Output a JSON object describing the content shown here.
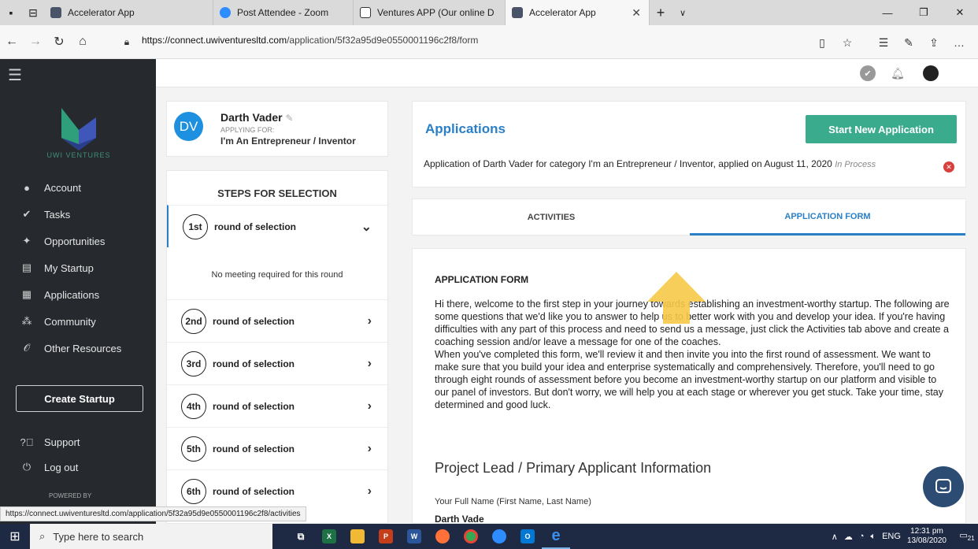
{
  "browser": {
    "tabs": [
      {
        "label": "Accelerator App",
        "color": "#4a5468"
      },
      {
        "label": "Post Attendee - Zoom",
        "color": "#2d8cff"
      },
      {
        "label": "Ventures APP (Our online D",
        "color": "#ffffff"
      },
      {
        "label": "Accelerator App",
        "color": "#4a5468",
        "active": true
      }
    ],
    "url_host": "https://connect.uwiventuresltd.com",
    "url_path": "/application/5f32a95d9e0550001196c2f8/form"
  },
  "sidebar": {
    "logo_text": "UWI VENTURES",
    "items": [
      {
        "label": "Account",
        "icon": "person-icon"
      },
      {
        "label": "Tasks",
        "icon": "check-circle-icon"
      },
      {
        "label": "Opportunities",
        "icon": "megaphone-icon"
      },
      {
        "label": "My Startup",
        "icon": "document-icon"
      },
      {
        "label": "Applications",
        "icon": "building-icon"
      },
      {
        "label": "Community",
        "icon": "people-icon"
      },
      {
        "label": "Other Resources",
        "icon": "paperclip-icon"
      }
    ],
    "create_startup": "Create Startup",
    "support": "Support",
    "logout": "Log out",
    "powered_by": "POWERED BY"
  },
  "profile": {
    "initials": "DV",
    "name": "Darth Vader",
    "applying_for_label": "APPLYING FOR:",
    "category": "I'm An Entrepreneur / Inventor"
  },
  "steps": {
    "title": "STEPS FOR SELECTION",
    "no_meeting": "No meeting required for this round",
    "rounds": [
      {
        "ord": "1st",
        "label": "round of selection"
      },
      {
        "ord": "2nd",
        "label": "round of selection"
      },
      {
        "ord": "3rd",
        "label": "round of selection"
      },
      {
        "ord": "4th",
        "label": "round of selection"
      },
      {
        "ord": "5th",
        "label": "round of selection"
      },
      {
        "ord": "6th",
        "label": "round of selection"
      }
    ]
  },
  "applications": {
    "title": "Applications",
    "start_button": "Start New Application",
    "entry_text": "Application of Darth Vader for category I'm an Entrepreneur / Inventor, applied on August 11, 2020",
    "entry_status": "In Process"
  },
  "tabs": {
    "activities": "ACTIVITIES",
    "application_form": "APPLICATION FORM"
  },
  "form": {
    "heading": "APPLICATION FORM",
    "intro_1": "Hi there, welcome to the first step in your journey towards establishing an investment-worthy startup. The following are some questions that we'd like you to answer to help us to better work with you and develop your idea. If you're having difficulties with any part of this process and need to send us a message, just click the Activities tab above and create a coaching session and/or leave a message for one of the coaches.",
    "intro_2": "When you've completed this form, we'll review it and then invite you into the first round of assessment. We want to make sure that you build your idea and enterprise systematically and comprehensively. Therefore, you'll need to go through eight rounds of assessment before you become an investment-worthy startup on our platform and visible to our panel of investors. But don't worry, we will help you at each stage or wherever you get stuck. Take your time, stay determined and good luck.",
    "section_title": "Project Lead / Primary Applicant Information",
    "fullname_label": "Your Full Name (First Name, Last Name)",
    "fullname_value": "Darth Vade"
  },
  "status_bar_url": "https://connect.uwiventuresltd.com/application/5f32a95d9e0550001196c2f8/activities",
  "taskbar": {
    "search_placeholder": "Type here to search",
    "lang": "ENG",
    "time": "12:31 pm",
    "date": "13/08/2020",
    "notif_count": "21"
  },
  "colors": {
    "accent": "#2a7fc6",
    "green": "#3aab8c",
    "sidebar": "#26292e"
  }
}
